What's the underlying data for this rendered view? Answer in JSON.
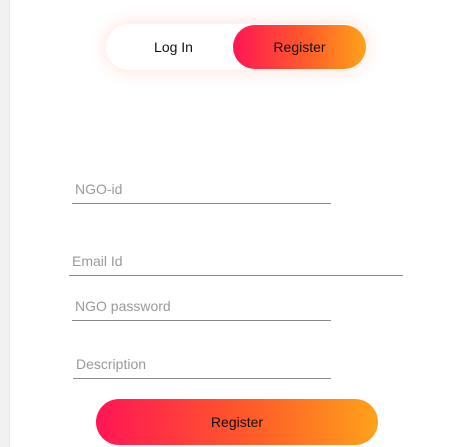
{
  "auth_toggle": {
    "login_label": "Log In",
    "register_label": "Register",
    "active": "register"
  },
  "form": {
    "ngo_id": {
      "placeholder": "NGO-id",
      "value": ""
    },
    "email": {
      "placeholder": "Email Id",
      "value": ""
    },
    "password": {
      "placeholder": "NGO password",
      "value": ""
    },
    "description": {
      "placeholder": "Description",
      "value": ""
    },
    "submit_label": "Register"
  },
  "colors": {
    "gradient_start": "#ff1654",
    "gradient_mid": "#ff5b2a",
    "gradient_end": "#ffa21a",
    "text": "#111111",
    "placeholder": "#9a9a9a",
    "underline": "#8a8a8a"
  }
}
